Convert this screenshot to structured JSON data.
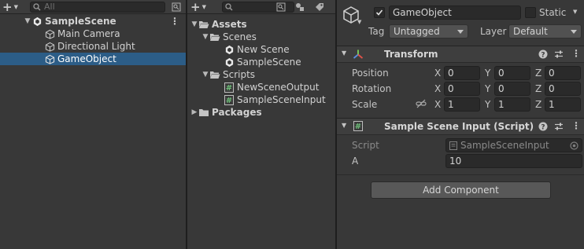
{
  "hierarchy": {
    "search_placeholder": "All",
    "scene_name": "SampleScene",
    "items": [
      {
        "label": "Main Camera"
      },
      {
        "label": "Directional Light"
      },
      {
        "label": "GameObject"
      }
    ]
  },
  "project": {
    "tree": {
      "assets": "Assets",
      "scenes": "Scenes",
      "scene_files": [
        "New Scene",
        "SampleScene"
      ],
      "scripts": "Scripts",
      "script_files": [
        "NewSceneOutput",
        "SampleSceneInput"
      ],
      "packages": "Packages"
    }
  },
  "inspector": {
    "object_name": "GameObject",
    "static_label": "Static",
    "tag_label": "Tag",
    "tag_value": "Untagged",
    "layer_label": "Layer",
    "layer_value": "Default",
    "transform": {
      "title": "Transform",
      "position_label": "Position",
      "rotation_label": "Rotation",
      "scale_label": "Scale",
      "axis_x": "X",
      "axis_y": "Y",
      "axis_z": "Z",
      "position": [
        "0",
        "0",
        "0"
      ],
      "rotation": [
        "0",
        "0",
        "0"
      ],
      "scale": [
        "1",
        "1",
        "1"
      ]
    },
    "script_component": {
      "title": "Sample Scene Input (Script)",
      "script_label": "Script",
      "script_value": "SampleSceneInput",
      "a_label": "A",
      "a_value": "10"
    },
    "add_component_label": "Add Component"
  },
  "colors": {
    "selection": "#2c5d87",
    "panel_bg": "#383838",
    "field_bg": "#2a2a2a"
  }
}
